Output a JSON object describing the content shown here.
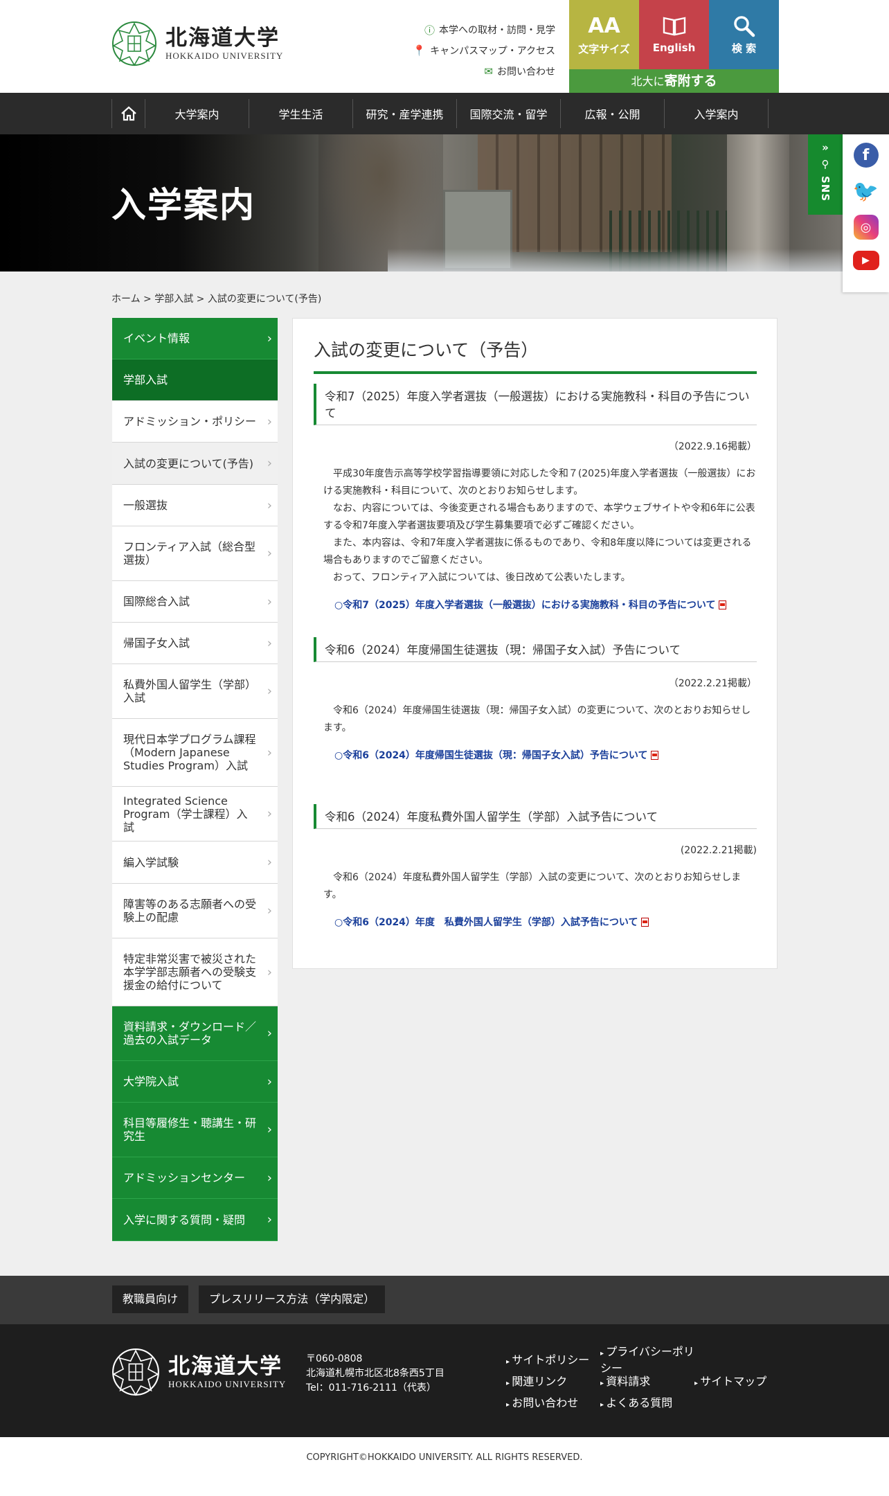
{
  "header": {
    "logo_jp": "北海道大学",
    "logo_en": "HOKKAIDO UNIVERSITY",
    "util_links": [
      {
        "icon": "info-circle-icon",
        "label": "本学への取材・訪問・見学"
      },
      {
        "icon": "map-pin-icon",
        "label": "キャンパスマップ・アクセス"
      },
      {
        "icon": "mail-icon",
        "label": "お問い合わせ"
      }
    ],
    "buttons": {
      "font_size_glyph": "AA",
      "font_size_label": "文字サイズ",
      "english_label": "English",
      "search_label": "検 索"
    },
    "donate_prefix": "北大に",
    "donate_bold": "寄附する"
  },
  "nav": {
    "home_icon": "home-icon",
    "items": [
      "大学案内",
      "学生生活",
      "研究・産学連携",
      "国際交流・留学",
      "広報・公開",
      "入学案内"
    ]
  },
  "hero": {
    "title": "入学案内"
  },
  "sns": {
    "tab_label": "SNS",
    "icons": [
      "facebook-icon",
      "twitter-icon",
      "instagram-icon",
      "youtube-icon"
    ]
  },
  "breadcrumb": "ホーム > 学部入試 > 入試の変更について(予告)",
  "sidebar": {
    "items": [
      {
        "label": "イベント情報",
        "style": "green",
        "h": 60
      },
      {
        "label": "学部入試",
        "style": "dark",
        "h": 60
      },
      {
        "label": "アドミッション・ポリシー",
        "style": "white",
        "h": 60
      },
      {
        "label": "入試の変更について(予告)",
        "style": "current",
        "h": 61
      },
      {
        "label": "一般選抜",
        "style": "white",
        "h": 60
      },
      {
        "label": "フロンティア入試（総合型選抜）",
        "style": "white",
        "h": 79
      },
      {
        "label": "国際総合入試",
        "style": "white",
        "h": 60
      },
      {
        "label": "帰国子女入試",
        "style": "white",
        "h": 60
      },
      {
        "label": "私費外国人留学生（学部）入試",
        "style": "white",
        "h": 79
      },
      {
        "label": "現代日本学プログラム課程（Modern Japanese Studies Program）入試",
        "style": "white",
        "h": 98
      },
      {
        "label": "Integrated Science Program（学士課程）入試",
        "style": "white",
        "h": 79
      },
      {
        "label": "編入学試験",
        "style": "white",
        "h": 61
      },
      {
        "label": "障害等のある志願者への受験上の配慮",
        "style": "white",
        "h": 79
      },
      {
        "label": "特定非常災害で被災された本学学部志願者への受験支援金の給付について",
        "style": "white",
        "h": 98
      },
      {
        "label": "資料請求・ダウンロード／過去の入試データ",
        "style": "green",
        "h": 79
      },
      {
        "label": "大学院入試",
        "style": "green",
        "h": 60
      },
      {
        "label": "科目等履修生・聴講生・研究生",
        "style": "green",
        "h": 79
      },
      {
        "label": "アドミッションセンター",
        "style": "green",
        "h": 60
      },
      {
        "label": "入学に関する質問・疑問",
        "style": "green",
        "h": 61
      }
    ]
  },
  "main": {
    "title": "入試の変更について（予告）",
    "sections": [
      {
        "heading": "令和7（2025）年度入学者選抜（一般選抜）における実施教科・科目の予告について",
        "date": "（2022.9.16掲載）",
        "paragraphs": [
          "平成30年度告示高等学校学習指導要領に対応した令和７(2025)年度入学者選抜（一般選抜）における実施教科・科目について、次のとおりお知らせします。",
          "なお、内容については、今後変更される場合もありますので、本学ウェブサイトや令和6年に公表する令和7年度入学者選抜要項及び学生募集要項で必ずご確認ください。",
          "また、本内容は、令和7年度入学者選抜に係るものであり、令和8年度以降については変更される場合もありますのでご留意ください。",
          "おって、フロンティア入試については、後日改めて公表いたします。"
        ],
        "link": "○令和7（2025）年度入学者選抜（一般選抜）における実施教科・科目の予告について"
      },
      {
        "heading": "令和6（2024）年度帰国生徒選抜（現：帰国子女入試）予告について",
        "date": "（2022.2.21掲載）",
        "paragraphs": [
          "令和6（2024）年度帰国生徒選抜（現：帰国子女入試）の変更について、次のとおりお知らせします。"
        ],
        "link": "○令和6（2024）年度帰国生徒選抜（現：帰国子女入試）予告について"
      },
      {
        "heading": "令和6（2024）年度私費外国人留学生（学部）入試予告について",
        "date": "(2022.2.21掲載)",
        "paragraphs": [
          "令和6（2024）年度私費外国人留学生（学部）入試の変更について、次のとおりお知らせします。"
        ],
        "link": "○令和6（2024）年度　私費外国人留学生（学部）入試予告について"
      }
    ]
  },
  "footer": {
    "buttons": [
      "教職員向け",
      "プレスリリース方法（学内限定）"
    ],
    "logo_jp": "北海道大学",
    "logo_en": "HOKKAIDO UNIVERSITY",
    "address": [
      "〒060-0808",
      "北海道札幌市北区北8条西5丁目",
      "Tel：011-716-2111（代表）"
    ],
    "links": [
      [
        "サイトポリシー",
        "プライバシーポリシー"
      ],
      [
        "関連リンク",
        "資料請求",
        "サイトマップ"
      ],
      [
        "お問い合わせ",
        "よくある質問"
      ]
    ],
    "copyright": "COPYRIGHT©HOKKAIDO UNIVERSITY. ALL RIGHTS RESERVED."
  }
}
